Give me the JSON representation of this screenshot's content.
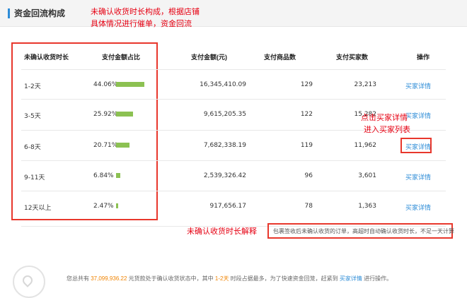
{
  "header": {
    "title": "资金回流构成"
  },
  "annotations": {
    "top_line1": "未确认收货时长构成，根据店铺",
    "top_line2": "具体情况进行催单，资金回流",
    "click_line1": "点击买家详情",
    "click_line2": "进入买家列表",
    "explain": "未确认收货时长解释"
  },
  "table": {
    "columns": [
      "未确认收货时长",
      "支付金额占比",
      "支付金额(元)",
      "支付商品数",
      "支付买家数",
      "操作"
    ],
    "rows": [
      {
        "duration": "1-2天",
        "pct": "44.06%",
        "pct_value": 44.06,
        "amount": "16,345,410.09",
        "items": "129",
        "buyers": "23,213",
        "action": "买家详情"
      },
      {
        "duration": "3-5天",
        "pct": "25.92%",
        "pct_value": 25.92,
        "amount": "9,615,205.35",
        "items": "122",
        "buyers": "15,282",
        "action": "买家详情"
      },
      {
        "duration": "6-8天",
        "pct": "20.71%",
        "pct_value": 20.71,
        "amount": "7,682,338.19",
        "items": "119",
        "buyers": "11,962",
        "action": "买家详情"
      },
      {
        "duration": "9-11天",
        "pct": "6.84%",
        "pct_value": 6.84,
        "amount": "2,539,326.42",
        "items": "96",
        "buyers": "3,601",
        "action": "买家详情"
      },
      {
        "duration": "12天以上",
        "pct": "2.47%",
        "pct_value": 2.47,
        "amount": "917,656.17",
        "items": "78",
        "buyers": "1,363",
        "action": "买家详情"
      }
    ]
  },
  "note": "包裹签收后未确认收货的订单，高超时自动确认收货时长，不足一天计算",
  "footer": {
    "prefix": "您总共有",
    "total": "37,099,936.22",
    "middle": "元货款处于确认收货状态中，其中",
    "range": "1-2天",
    "suffix": "时段占据最多，为了快速资金回笼，赶紧到",
    "link": "买家详情",
    "end": "进行操作。"
  },
  "colors": {
    "accent": "#2d8cd7",
    "bar": "#8cc152",
    "annotation": "#e60012",
    "highlight": "#f08300"
  }
}
